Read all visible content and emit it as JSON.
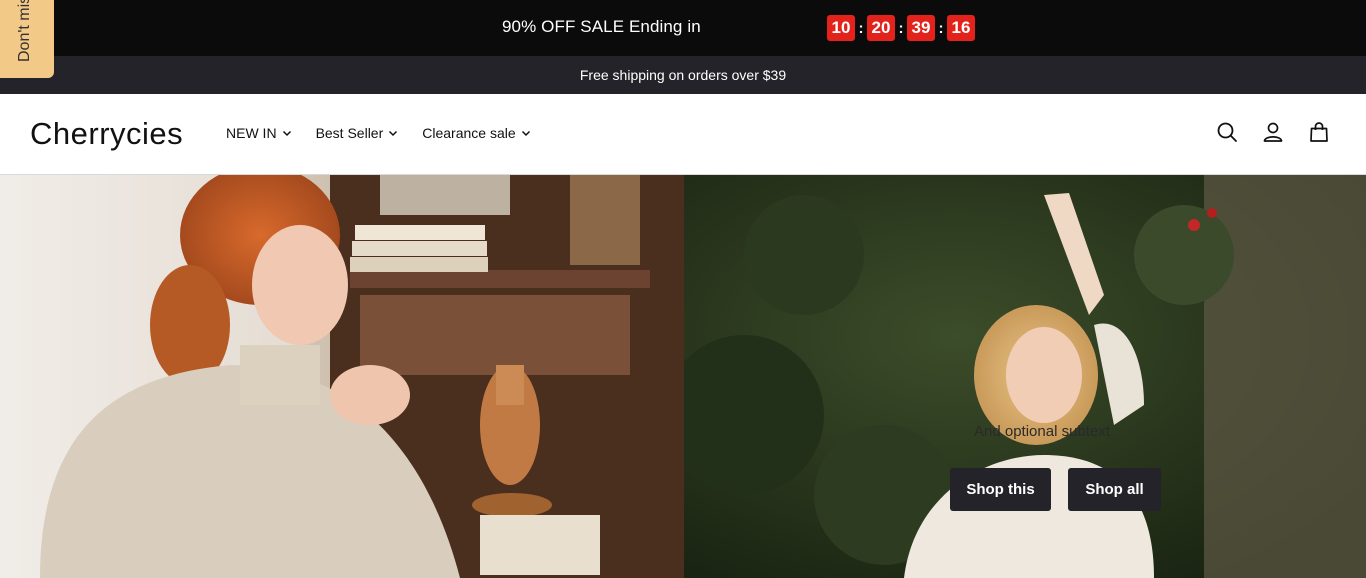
{
  "announcement": {
    "sale_text": "90% OFF SALE Ending in",
    "countdown": [
      "10",
      "20",
      "39",
      "16"
    ]
  },
  "shipping": {
    "text": "Free shipping on orders over $39"
  },
  "side_tab": {
    "label": "Don't miss"
  },
  "header": {
    "logo": "Cherrycies",
    "nav": [
      "NEW IN",
      "Best Seller",
      "Clearance sale"
    ],
    "icons": [
      "search-icon",
      "account-icon",
      "cart-icon"
    ]
  },
  "hero": {
    "subtext": "And optional subtext",
    "buttons": [
      "Shop this",
      "Shop all"
    ]
  }
}
